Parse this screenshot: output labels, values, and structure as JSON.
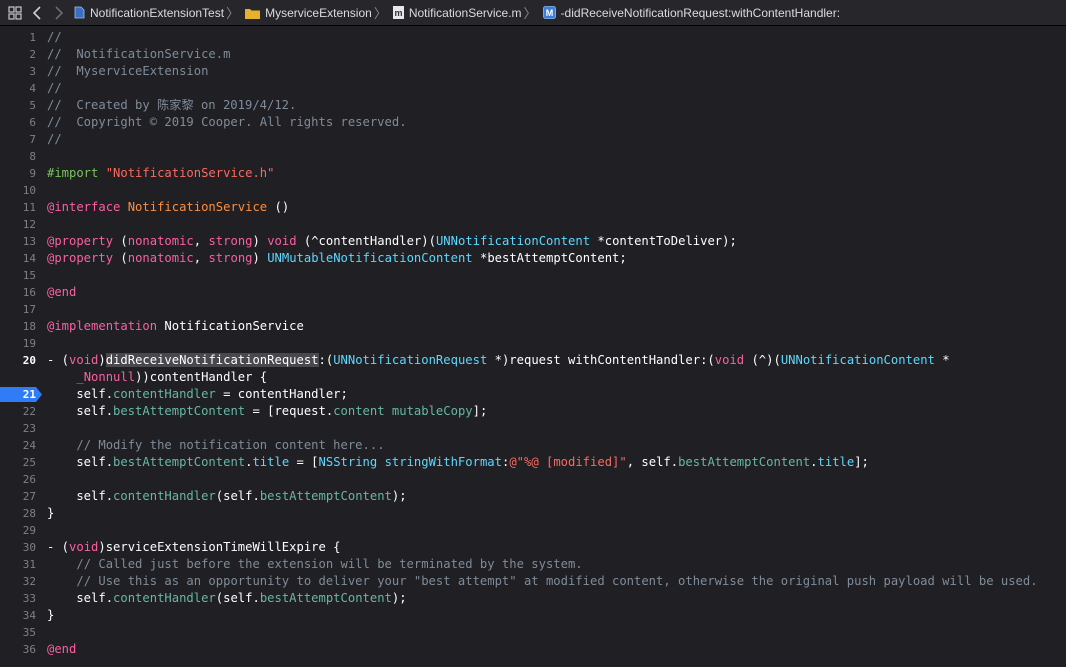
{
  "jumpbar": {
    "crumbs": [
      {
        "label": "NotificationExtensionTest",
        "icon": "file-icon"
      },
      {
        "label": "MyserviceExtension",
        "icon": "folder-icon"
      },
      {
        "label": "NotificationService.m",
        "icon": "m-file-icon"
      },
      {
        "label": "-didReceiveNotificationRequest:withContentHandler:",
        "icon": "method-icon"
      }
    ]
  },
  "editor": {
    "current_line": 20,
    "breakpoint_line": 21,
    "lines": [
      {
        "n": "1",
        "tokens": [
          [
            "c",
            "//"
          ]
        ]
      },
      {
        "n": "2",
        "tokens": [
          [
            "c",
            "//  NotificationService.m"
          ]
        ]
      },
      {
        "n": "3",
        "tokens": [
          [
            "c",
            "//  MyserviceExtension"
          ]
        ]
      },
      {
        "n": "4",
        "tokens": [
          [
            "c",
            "//"
          ]
        ]
      },
      {
        "n": "5",
        "tokens": [
          [
            "c",
            "//  Created by 陈家黎 on 2019/4/12."
          ]
        ]
      },
      {
        "n": "6",
        "tokens": [
          [
            "c",
            "//  Copyright © 2019 Cooper. All rights reserved."
          ]
        ]
      },
      {
        "n": "7",
        "tokens": [
          [
            "c",
            "//"
          ]
        ]
      },
      {
        "n": "8",
        "tokens": []
      },
      {
        "n": "9",
        "tokens": [
          [
            "pre",
            "#import "
          ],
          [
            "s",
            "\"NotificationService.h\""
          ]
        ]
      },
      {
        "n": "10",
        "tokens": []
      },
      {
        "n": "11",
        "tokens": [
          [
            "k",
            "@interface "
          ],
          [
            "dec",
            "NotificationService"
          ],
          [
            "i",
            " ()"
          ]
        ]
      },
      {
        "n": "12",
        "tokens": []
      },
      {
        "n": "13",
        "tokens": [
          [
            "k",
            "@property"
          ],
          [
            "i",
            " ("
          ],
          [
            "k",
            "nonatomic"
          ],
          [
            "i",
            ", "
          ],
          [
            "k",
            "strong"
          ],
          [
            "i",
            ") "
          ],
          [
            "k",
            "void"
          ],
          [
            "i",
            " (^contentHandler)("
          ],
          [
            "t",
            "UNNotificationContent"
          ],
          [
            "i",
            " *contentToDeliver);"
          ]
        ]
      },
      {
        "n": "14",
        "tokens": [
          [
            "k",
            "@property"
          ],
          [
            "i",
            " ("
          ],
          [
            "k",
            "nonatomic"
          ],
          [
            "i",
            ", "
          ],
          [
            "k",
            "strong"
          ],
          [
            "i",
            ") "
          ],
          [
            "t",
            "UNMutableNotificationContent"
          ],
          [
            "i",
            " *bestAttemptContent;"
          ]
        ]
      },
      {
        "n": "15",
        "tokens": []
      },
      {
        "n": "16",
        "tokens": [
          [
            "k",
            "@end"
          ]
        ]
      },
      {
        "n": "17",
        "tokens": []
      },
      {
        "n": "18",
        "tokens": [
          [
            "k",
            "@implementation"
          ],
          [
            "i",
            " NotificationService"
          ]
        ]
      },
      {
        "n": "19",
        "tokens": []
      },
      {
        "n": "20",
        "tokens": [
          [
            "i",
            "- ("
          ],
          [
            "k",
            "void"
          ],
          [
            "i",
            ")"
          ],
          [
            "hl",
            "didReceiveNotificationRequest"
          ],
          [
            "i",
            ":("
          ],
          [
            "t",
            "UNNotificationRequest"
          ],
          [
            "i",
            " *)request withContentHandler:("
          ],
          [
            "k",
            "void"
          ],
          [
            "i",
            " (^)("
          ],
          [
            "t",
            "UNNotificationContent"
          ],
          [
            "i",
            " *"
          ]
        ]
      },
      {
        "n": "",
        "tokens": [
          [
            "i",
            "    "
          ],
          [
            "k",
            "_Nonnull"
          ],
          [
            "i",
            "))contentHandler {"
          ]
        ]
      },
      {
        "n": "21",
        "tokens": [
          [
            "i",
            "    self."
          ],
          [
            "p",
            "contentHandler"
          ],
          [
            "i",
            " = contentHandler;"
          ]
        ]
      },
      {
        "n": "22",
        "tokens": [
          [
            "i",
            "    self."
          ],
          [
            "p",
            "bestAttemptContent"
          ],
          [
            "i",
            " = [request."
          ],
          [
            "p",
            "content"
          ],
          [
            "i",
            " "
          ],
          [
            "p",
            "mutableCopy"
          ],
          [
            "i",
            "];"
          ]
        ]
      },
      {
        "n": "23",
        "tokens": []
      },
      {
        "n": "24",
        "tokens": [
          [
            "i",
            "    "
          ],
          [
            "c",
            "// Modify the notification content here..."
          ]
        ]
      },
      {
        "n": "25",
        "tokens": [
          [
            "i",
            "    self."
          ],
          [
            "p",
            "bestAttemptContent"
          ],
          [
            "i",
            "."
          ],
          [
            "t",
            "title"
          ],
          [
            "i",
            " = ["
          ],
          [
            "t",
            "NSString"
          ],
          [
            "i",
            " "
          ],
          [
            "t",
            "stringWithFormat"
          ],
          [
            "i",
            ":"
          ],
          [
            "s",
            "@\"%@ [modified]\""
          ],
          [
            "i",
            ", self."
          ],
          [
            "p",
            "bestAttemptContent"
          ],
          [
            "i",
            "."
          ],
          [
            "t",
            "title"
          ],
          [
            "i",
            "];"
          ]
        ]
      },
      {
        "n": "26",
        "tokens": []
      },
      {
        "n": "27",
        "tokens": [
          [
            "i",
            "    self."
          ],
          [
            "p",
            "contentHandler"
          ],
          [
            "i",
            "(self."
          ],
          [
            "p",
            "bestAttemptContent"
          ],
          [
            "i",
            ");"
          ]
        ]
      },
      {
        "n": "28",
        "tokens": [
          [
            "i",
            "}"
          ]
        ]
      },
      {
        "n": "29",
        "tokens": []
      },
      {
        "n": "30",
        "tokens": [
          [
            "i",
            "- ("
          ],
          [
            "k",
            "void"
          ],
          [
            "i",
            ")serviceExtensionTimeWillExpire {"
          ]
        ]
      },
      {
        "n": "31",
        "tokens": [
          [
            "i",
            "    "
          ],
          [
            "c",
            "// Called just before the extension will be terminated by the system."
          ]
        ]
      },
      {
        "n": "32",
        "tokens": [
          [
            "i",
            "    "
          ],
          [
            "c",
            "// Use this as an opportunity to deliver your \"best attempt\" at modified content, otherwise the original push payload will be used."
          ]
        ]
      },
      {
        "n": "33",
        "tokens": [
          [
            "i",
            "    self."
          ],
          [
            "p",
            "contentHandler"
          ],
          [
            "i",
            "(self."
          ],
          [
            "p",
            "bestAttemptContent"
          ],
          [
            "i",
            ");"
          ]
        ]
      },
      {
        "n": "34",
        "tokens": [
          [
            "i",
            "}"
          ]
        ]
      },
      {
        "n": "35",
        "tokens": []
      },
      {
        "n": "36",
        "tokens": [
          [
            "k",
            "@end"
          ]
        ]
      }
    ]
  },
  "colors": {
    "background": "#1f1f24",
    "comment": "#7f8c98",
    "keyword": "#fc5fa3",
    "type": "#5dd8ff",
    "string": "#fc6a5d",
    "property": "#67b7a4",
    "preprocessor": "#7bc25d",
    "declaration": "#fd8f3f",
    "breakpoint": "#2f7cf6"
  }
}
